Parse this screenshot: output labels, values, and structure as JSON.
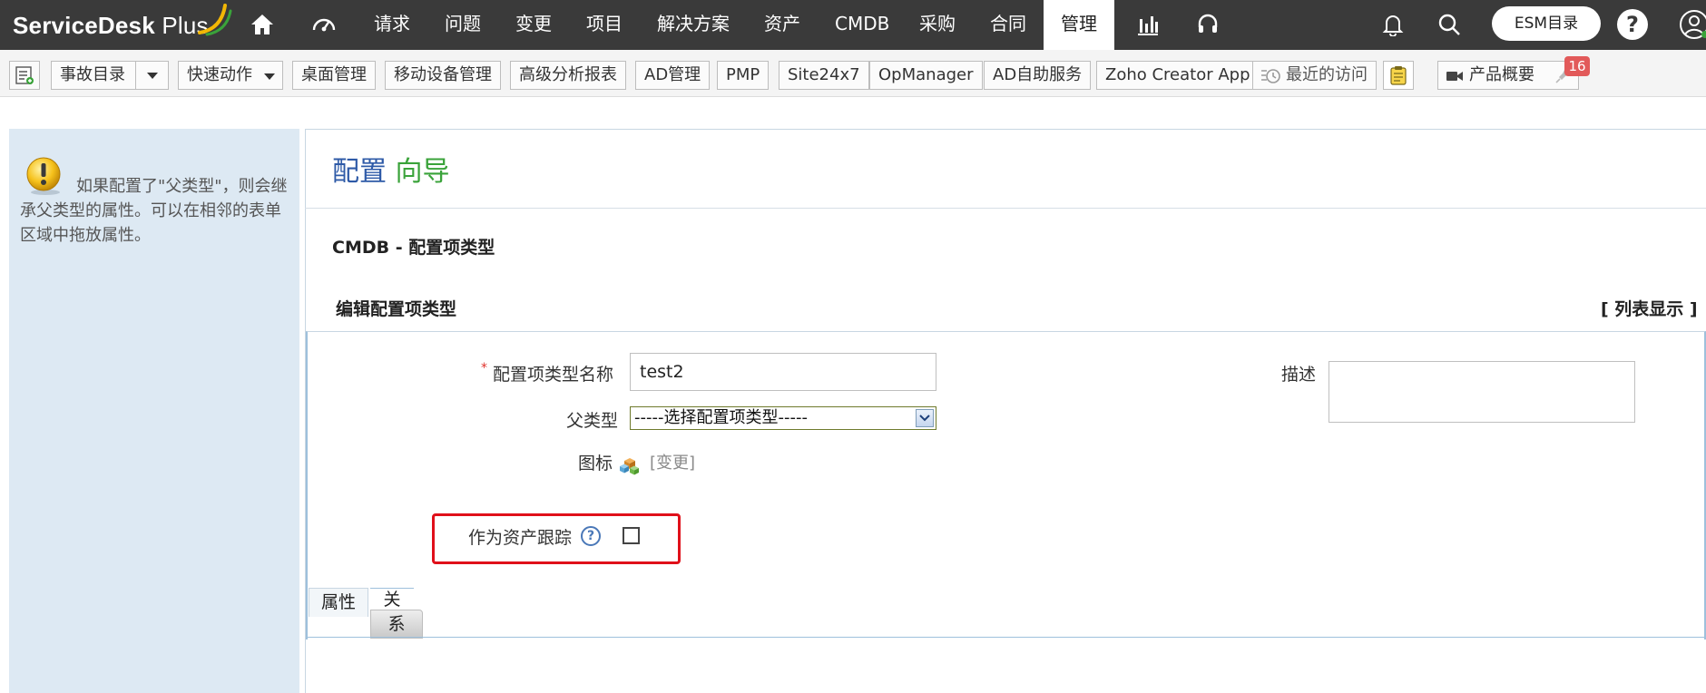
{
  "app": {
    "logo": "ServiceDesk Plus"
  },
  "nav": {
    "items": [
      {
        "label": "请求"
      },
      {
        "label": "问题"
      },
      {
        "label": "变更"
      },
      {
        "label": "项目"
      },
      {
        "label": "解决方案"
      },
      {
        "label": "资产"
      },
      {
        "label": "CMDB"
      },
      {
        "label": "采购"
      },
      {
        "label": "合同"
      },
      {
        "label": "管理",
        "active": true
      }
    ],
    "icons": [
      "home-icon",
      "dashboard-gauge-icon",
      "reports-chart-icon",
      "headset-icon",
      "bell-icon",
      "search-icon",
      "help-icon",
      "user-icon"
    ],
    "esm_label": "ESM目录",
    "help_label": "?"
  },
  "toolbar": {
    "incident_catalog": "事故目录",
    "quick_actions": "快速动作",
    "desktop_mgmt": "桌面管理",
    "mobile_mgmt": "移动设备管理",
    "advanced_reports": "高级分析报表",
    "ad_mgmt": "AD管理",
    "pmp": "PMP",
    "site24x7": "Site24x7",
    "opmanager": "OpManager",
    "ad_self_service": "AD自助服务",
    "zoho_creator": "Zoho Creator App",
    "recent_visits": "最近的访问",
    "product_overview": "产品概要",
    "notification_count": "16"
  },
  "hint": {
    "text": "如果配置了\"父类型\"，则会继承父类型的属性。可以在相邻的表单区域中拖放属性。"
  },
  "page": {
    "title_part1": "配置",
    "title_part2": "向导",
    "section": "CMDB - 配置项类型",
    "subsection": "编辑配置项类型",
    "list_view": "[ 列表显示 ]"
  },
  "form": {
    "required_mark": "*",
    "name_label": "配置项类型名称",
    "name_value": "test2",
    "parent_label": "父类型",
    "parent_selected": "-----选择配置项类型-----",
    "icon_label": "图标",
    "change_link": "[变更]",
    "desc_label": "描述",
    "desc_value": "",
    "asset_track_label": "作为资产跟踪",
    "asset_track_help": "?",
    "asset_track_checked": false
  },
  "tabs": {
    "attributes": "属性",
    "relations_top": "关",
    "relations_bottom": "系"
  },
  "colors": {
    "topbar": "#3a3a3a",
    "title_blue": "#2e5aa7",
    "title_green": "#3aa33a",
    "hint_bg": "#dde9f3",
    "highlight_red": "#e0101a",
    "badge_red": "#e25a5a"
  }
}
